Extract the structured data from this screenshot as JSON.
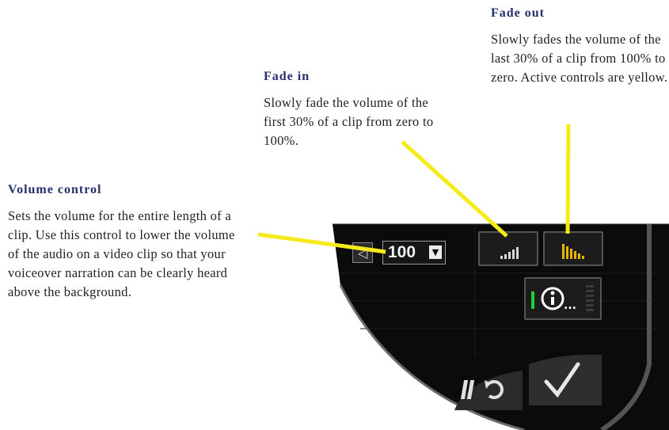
{
  "callouts": {
    "volume": {
      "title": "Volume control",
      "body": "Sets the volume for the entire length of a clip. Use this control to lower the volume of the audio on a video clip so that your voiceover narration can be clearly heard above the background."
    },
    "fade_in": {
      "title": "Fade in",
      "body": "Slowly fade the volume of the first 30% of a clip from zero to 100%."
    },
    "fade_out": {
      "title": "Fade out",
      "body": "Slowly fades the volume of  the last 30% of a clip from 100% to zero. Active controls are yellow."
    }
  },
  "panel": {
    "volume_value": "100",
    "colors": {
      "background": "#0b0b0b",
      "pointer": "#f7ea1a",
      "active_icon": "#e8b400",
      "inactive_icon": "#d9d9d9",
      "indicator": "#21d13b"
    },
    "icons": [
      "speaker-icon",
      "dropdown-arrow-icon",
      "fade-in-icon",
      "fade-out-icon",
      "info-icon",
      "undo-icon",
      "checkmark-icon"
    ]
  }
}
